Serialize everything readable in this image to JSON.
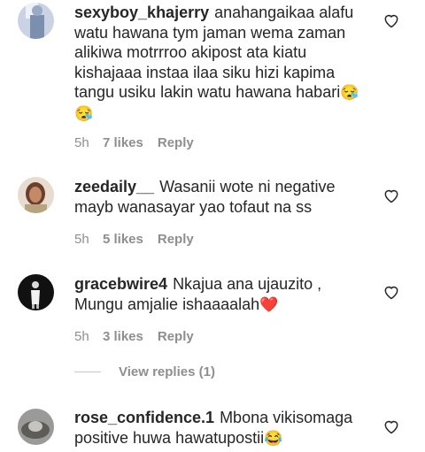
{
  "comments": [
    {
      "username": "sexyboy_khajerry",
      "text": "anahangaikaa alafu watu hawana tym jaman wema zaman alikiwa motrrroo akipost ata kiatu kishajaaa instaa ilaa siku hizi kapima tangu usiku lakin watu hawana habari",
      "emoji": "😪😪",
      "time": "5h",
      "likes": "7 likes",
      "reply": "Reply"
    },
    {
      "username": "zeedaily__",
      "text": "Wasanii wote ni negative mayb wanasayar yao tofaut na ss",
      "emoji": "",
      "time": "5h",
      "likes": "5 likes",
      "reply": "Reply"
    },
    {
      "username": "gracebwire4",
      "text": "Nkajua ana ujauzito , Mungu amjalie ishaaaalah",
      "emoji": "❤️",
      "time": "5h",
      "likes": "3 likes",
      "reply": "Reply"
    },
    {
      "username": "rose_confidence.1",
      "text": "Mbona vikisomaga positive huwa hawatupostii",
      "emoji": "😂",
      "time": "",
      "likes": "",
      "reply": ""
    }
  ],
  "view_replies": "View replies (1)",
  "icons": {
    "like": "heart-outline-icon"
  },
  "colors": {
    "text": "#262626",
    "meta": "#8e8e8e",
    "emoji_heart": "#e0245e"
  }
}
